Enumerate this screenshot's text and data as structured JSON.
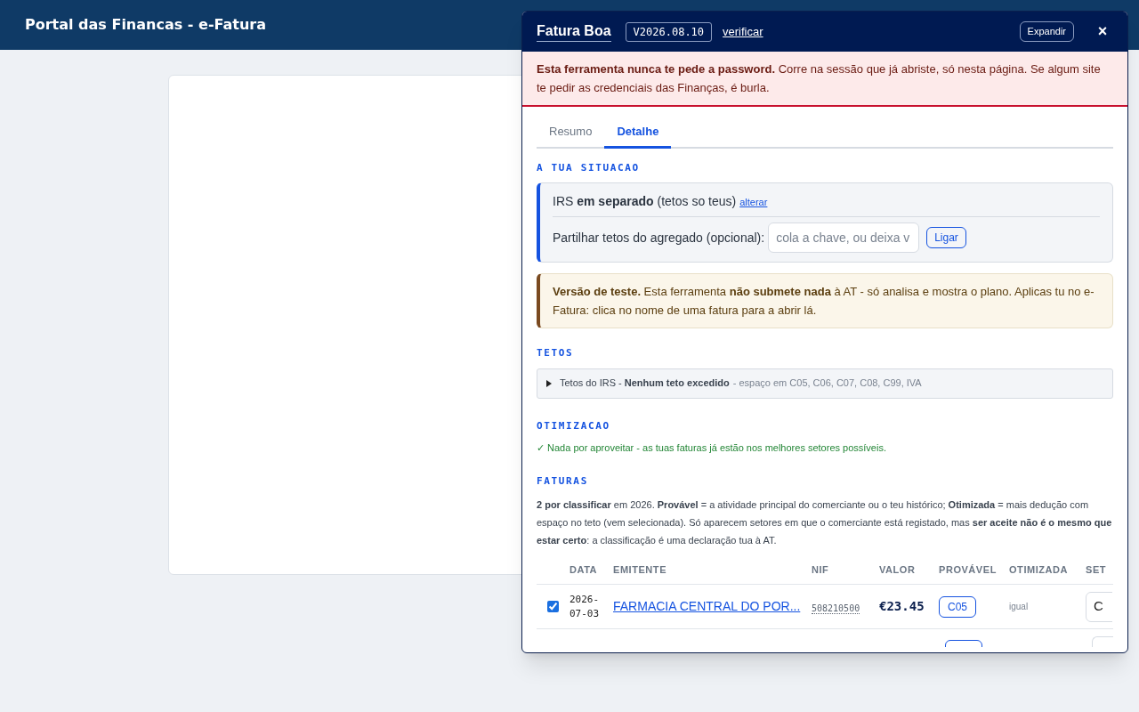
{
  "page": {
    "title": "Portal das Financas - e-Fatura"
  },
  "panel": {
    "title": "Fatura Boa",
    "version": "V2026.08.10",
    "verify_link": "verificar",
    "expand_button": "Expandir",
    "close_button": "×",
    "warning": "**Esta ferramenta nunca te pede a password.** Corre na sessão que já abriste, só nesta página. Se algum site te pedir as credenciais das Finanças, é burla.",
    "tabs": [
      {
        "label": "Resumo",
        "selected": false
      },
      {
        "label": "Detalhe",
        "selected": true
      }
    ],
    "situation": {
      "heading": "A TUA SITUACAO",
      "status": "IRS **em separado** (tetos so teus)",
      "change_link": "alterar",
      "share_label": "Partilhar tetos do agregado (opcional):",
      "share_field": {
        "placeholder": "cola a chave, ou deixa v"
      },
      "connect_button": "Ligar"
    },
    "test_notice": "**Versão de teste.** Esta ferramenta **não submete nada** à AT - só analisa e mostra o plano. Aplicas tu no e-Fatura: clica no nome de uma fatura para a abrir lá.",
    "limits": {
      "heading": "TETOS",
      "expanded": false,
      "summary": "Tetos do IRS - **Nenhum teto excedido**",
      "detail": "- espaço em C05, C06, C07, C08, C99, IVA"
    },
    "optimization": {
      "heading": "OTIMIZACAO",
      "message": "✓ Nada por aproveitar - as tuas faturas já estão nos melhores setores possíveis."
    },
    "invoices": {
      "heading": "FATURAS",
      "intro": "**2 por classificar** em 2026. **Provável** = a atividade principal do comerciante ou o teu histórico; **Otimizada** = mais dedução com espaço no teto (vem selecionada). Só aparecem setores em que o comerciante está registado, mas **ser aceite não é o mesmo que estar certo**: a classificação é uma declaração tua à AT.",
      "columns": [
        "DATA",
        "EMITENTE",
        "NIF",
        "VALOR",
        "PROVÁVEL",
        "OTIMIZADA",
        "SET"
      ],
      "rows": [
        {
          "checked": true,
          "date": "2026-07-03",
          "issuer": "FARMACIA CENTRAL DO POR...",
          "nif": "508210500",
          "amount": "€23.45",
          "likely": "C05",
          "optimized": "igual",
          "sector": "C"
        }
      ]
    }
  }
}
